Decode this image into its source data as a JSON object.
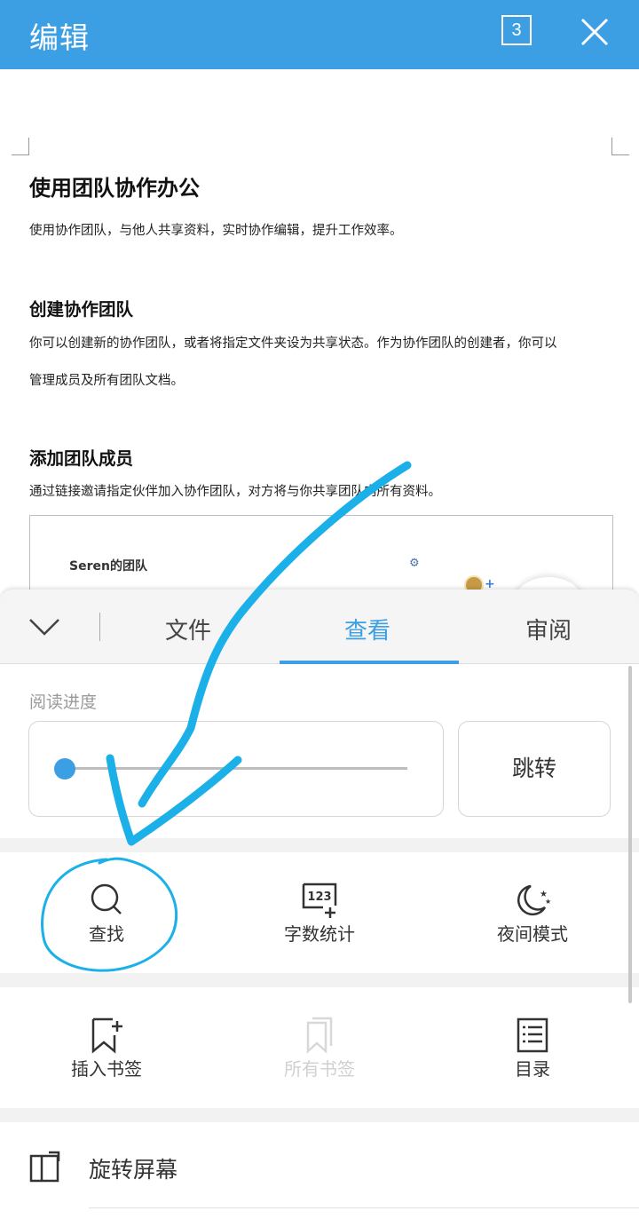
{
  "header": {
    "title": "编辑",
    "page_count": "3",
    "bg_color": "#3c9fe4"
  },
  "document": {
    "title": "使用团队协作办公",
    "intro": "使用协作团队，与他人共享资料，实时协作编辑，提升工作效率。",
    "section1": {
      "heading": "创建协作团队",
      "line1": "你可以创建新的协作团队，或者将指定文件夹设为共享状态。作为协作团队的创建者，你可以",
      "line2": "管理成员及所有团队文档。"
    },
    "section2": {
      "heading": "添加团队成员",
      "body": "通过链接邀请指定伙伴加入协作团队，对方将与你共享团队内所有资料。"
    },
    "embed": {
      "team_name": "Seren的团队",
      "gear": "⚙",
      "avatar_plus": "+"
    }
  },
  "panel": {
    "tabs": [
      {
        "label": "文件"
      },
      {
        "label": "查看",
        "active": true
      },
      {
        "label": "审阅"
      }
    ],
    "reading_progress": {
      "label": "阅读进度",
      "value_fraction": 0.0,
      "jump_label": "跳转"
    },
    "tools_row1": [
      {
        "label": "查找",
        "icon": "search-icon"
      },
      {
        "label": "字数统计",
        "icon": "word-count-icon",
        "icon_text": "123"
      },
      {
        "label": "夜间模式",
        "icon": "night-mode-icon"
      }
    ],
    "tools_row2": [
      {
        "label": "插入书签",
        "icon": "add-bookmark-icon"
      },
      {
        "label": "所有书签",
        "icon": "bookmarks-icon",
        "disabled": true
      },
      {
        "label": "目录",
        "icon": "toc-icon"
      }
    ],
    "rotate": {
      "label": "旋转屏幕",
      "icon": "rotate-screen-icon"
    }
  },
  "annotation": {
    "color": "#1cb0e8",
    "description_shapes": [
      "arrow",
      "circle"
    ]
  }
}
